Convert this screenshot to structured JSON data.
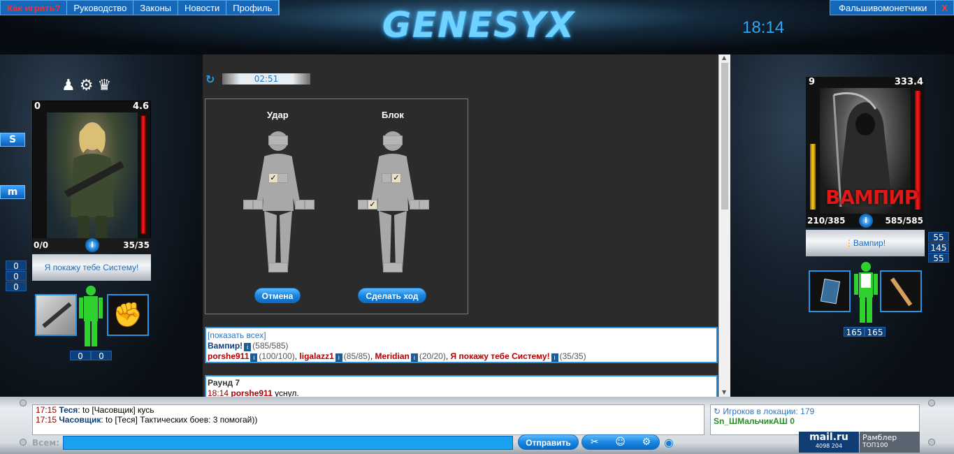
{
  "nav": {
    "items": [
      "Как играть?",
      "Руководство",
      "Законы",
      "Новости",
      "Профиль"
    ],
    "right_link": "Фальшивомонетчики",
    "close": "X"
  },
  "logo": "GENESYX",
  "clock": "18:14",
  "turn_timer": "02:51",
  "fight": {
    "attack_label": "Удар",
    "block_label": "Блок",
    "cancel_button": "Отмена",
    "make_move_button": "Сделать ход",
    "attack_zones_checked": [
      "belly"
    ],
    "block_zones_checked": [
      "belly-right",
      "left-hand"
    ]
  },
  "player": {
    "level": "0",
    "rating": "4.6",
    "hp_left": "0/0",
    "hp_right": "35/35",
    "name": "Я покажу тебе Систему!",
    "counters": [
      "0",
      "0",
      "0"
    ],
    "bottom_counters": [
      "0",
      "0"
    ]
  },
  "enemy": {
    "level": "9",
    "rating": "333.4",
    "caption": "ВАМПИР",
    "hp_left": "210/385",
    "hp_right": "585/585",
    "name": "Вампир!",
    "counters": [
      "55",
      "145",
      "55"
    ],
    "bottom_counters": [
      "165",
      "165"
    ]
  },
  "teams": {
    "show_all": "[показать всех]",
    "team1": [
      {
        "name": "Вампир!",
        "hp": "(585/585)"
      }
    ],
    "team2": [
      {
        "name": "porshe911",
        "hp": "(100/100)"
      },
      {
        "name": "ligalazz1",
        "hp": "(85/85)"
      },
      {
        "name": "Meridian",
        "hp": "(20/20)"
      },
      {
        "name": "Я покажу тебе Систему!",
        "hp": "(35/35)"
      }
    ]
  },
  "round": {
    "title": "Раунд 7",
    "time": "18:14",
    "user": "porshe911",
    "action": "уснул."
  },
  "chat": {
    "messages": [
      {
        "time": "17:15",
        "user": "Теся",
        "text": ": to [Часовщик] кусь"
      },
      {
        "time": "17:15",
        "user": "Часовщик",
        "text": ": to [Теся] Тактических боев: 3 помогай))"
      }
    ],
    "all_label": "Всем:",
    "send_button": "Отправить",
    "online_label": "Игроков в локации: 179",
    "online_partial": "Sn_ШМальчикАШ 0"
  },
  "counters_widgets": {
    "mailru": "mail.ru",
    "mailru_nums": "4098   204",
    "rambler": "Рамблер",
    "rambler_sub": "ТОП100"
  },
  "colors": {
    "accent": "#1767b9",
    "panel_border": "#2a93e0",
    "enemy_red": "#b00000",
    "ally_blue": "#0d3f7a"
  }
}
